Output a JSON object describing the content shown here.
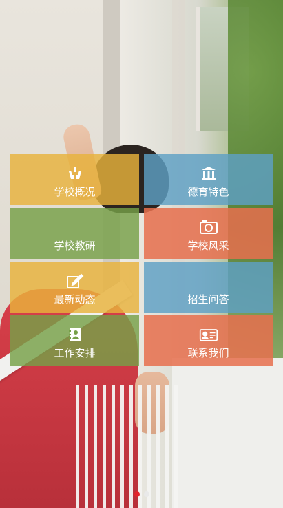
{
  "tiles": [
    {
      "label": "学校概况",
      "icon": "hands-icon",
      "color": "#e8b23c"
    },
    {
      "label": "德育特色",
      "icon": "building-icon",
      "color": "#5ea0c4"
    },
    {
      "label": "学校教研",
      "icon": "",
      "color": "#76a048"
    },
    {
      "label": "学校风采",
      "icon": "camera-icon",
      "color": "#e6704e"
    },
    {
      "label": "最新动态",
      "icon": "edit-icon",
      "color": "#e8b23c"
    },
    {
      "label": "招生问答",
      "icon": "",
      "color": "#5ea0c4"
    },
    {
      "label": "工作安排",
      "icon": "contact-book-icon",
      "color": "#76a048"
    },
    {
      "label": "联系我们",
      "icon": "id-card-icon",
      "color": "#e6704e"
    }
  ],
  "carousel": {
    "slide_count": 2,
    "active_index": 0,
    "active_color": "#e3232b"
  }
}
